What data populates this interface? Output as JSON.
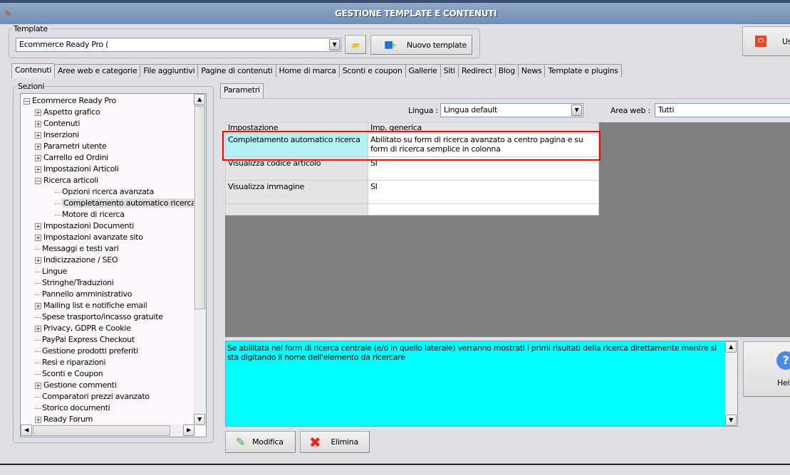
{
  "window": {
    "title": "GESTIONE TEMPLATE E CONTENUTI"
  },
  "template": {
    "label": "Template",
    "value": "Ecommerce Ready Pro (",
    "new_button": "Nuovo template"
  },
  "exit_button": "Us",
  "tabs": [
    "Contenuti",
    "Aree web e categorie",
    "File aggiuntivi",
    "Pagine di contenuti",
    "Home di marca",
    "Sconti e coupon",
    "Gallerie",
    "Siti",
    "Redirect",
    "Blog",
    "News",
    "Template e plugins"
  ],
  "sections": {
    "label": "Sezioni",
    "items": [
      {
        "label": "Ecommerce Ready Pro",
        "level": 0,
        "expander": "minus"
      },
      {
        "label": "Aspetto grafico",
        "level": 1,
        "expander": "plus"
      },
      {
        "label": "Contenuti",
        "level": 1,
        "expander": "plus"
      },
      {
        "label": "Inserzioni",
        "level": 1,
        "expander": "plus"
      },
      {
        "label": "Parametri utente",
        "level": 1,
        "expander": "plus"
      },
      {
        "label": "Carrello ed Ordini",
        "level": 1,
        "expander": "plus"
      },
      {
        "label": "Impostazioni Articoli",
        "level": 1,
        "expander": "plus"
      },
      {
        "label": "Ricerca articoli",
        "level": 1,
        "expander": "minus"
      },
      {
        "label": "Opzioni ricerca avanzata",
        "level": 2,
        "expander": ""
      },
      {
        "label": "Completamento automatico ricerca",
        "level": 2,
        "expander": "",
        "selected": true
      },
      {
        "label": "Motore di ricerca",
        "level": 2,
        "expander": ""
      },
      {
        "label": "Impostazioni Documenti",
        "level": 1,
        "expander": "plus"
      },
      {
        "label": "Impostazioni avanzate sito",
        "level": 1,
        "expander": "plus"
      },
      {
        "label": "Messaggi e testi vari",
        "level": 1,
        "expander": ""
      },
      {
        "label": "Indicizzazione / SEO",
        "level": 1,
        "expander": "plus"
      },
      {
        "label": "Lingue",
        "level": 1,
        "expander": ""
      },
      {
        "label": "Stringhe/Traduzioni",
        "level": 1,
        "expander": ""
      },
      {
        "label": "Pannello amministrativo",
        "level": 1,
        "expander": ""
      },
      {
        "label": "Mailing list e notifiche email",
        "level": 1,
        "expander": "plus"
      },
      {
        "label": "Spese trasporto/incasso gratuite",
        "level": 1,
        "expander": ""
      },
      {
        "label": "Privacy, GDPR e Cookie",
        "level": 1,
        "expander": "plus"
      },
      {
        "label": "PayPal Express Checkout",
        "level": 1,
        "expander": ""
      },
      {
        "label": "Gestione prodotti preferiti",
        "level": 1,
        "expander": ""
      },
      {
        "label": "Resi e riparazioni",
        "level": 1,
        "expander": ""
      },
      {
        "label": "Sconti e Coupon",
        "level": 1,
        "expander": ""
      },
      {
        "label": "Gestione commenti",
        "level": 1,
        "expander": "plus"
      },
      {
        "label": "Comparatori prezzi avanzato",
        "level": 1,
        "expander": ""
      },
      {
        "label": "Storico documenti",
        "level": 1,
        "expander": ""
      },
      {
        "label": "Ready Forum",
        "level": 1,
        "expander": "plus"
      }
    ]
  },
  "params": {
    "tab": "Parametri",
    "lingua_label": "Lingua :",
    "lingua_value": "Lingua default",
    "area_label": "Area web :",
    "area_value": "Tutti",
    "columns": [
      "Impostazione",
      "Imp. generica"
    ],
    "rows": [
      {
        "name": "Completamento automatico ricerca",
        "value": "Abilitato su form di ricerca avanzato a centro pagina e su form di ricerca semplice in colonna"
      },
      {
        "name": "Visualizza codice articolo",
        "value": "SI"
      },
      {
        "name": "Visualizza immagine",
        "value": "SI"
      },
      {
        "name": "",
        "value": ""
      }
    ]
  },
  "description": "Se abilitata nel form di ricerca centrale (e/o in quello laterale) verranno mostrati i primi risultati della ricerca direttamente mentre si sta digitando il nome dell'elemento da ricercare",
  "buttons": {
    "modifica": "Modifica",
    "elimina": "Elimina",
    "help": "Help"
  },
  "colors": {
    "selected_row": "#b4f0f2",
    "description_bg": "#00ffff",
    "highlight": "#ff0000"
  }
}
